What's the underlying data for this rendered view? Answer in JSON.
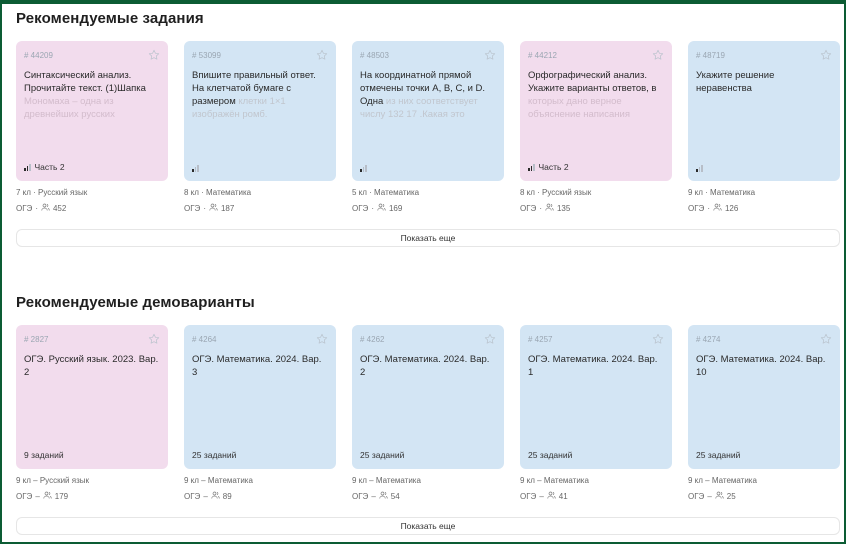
{
  "tasks": {
    "title": "Рекомендуемые задания",
    "show_more": "Показать еще",
    "cards": [
      {
        "color": "pink",
        "num": "# 44209",
        "text": "Синтаксический анализ. Прочитайте текст. (1)Шапка",
        "faded": "Мономаха – одна из древнейших русских",
        "level": 2,
        "part": "Часть 2",
        "grade": "7 кл",
        "subject": "Русский язык",
        "exam": "ОГЭ",
        "users": "452"
      },
      {
        "color": "blue",
        "num": "# 53099",
        "text": "Впишите правильный ответ. На клетчатой бумаге с размером",
        "faded": "клетки 1×1 изображён ромб.",
        "level": 1,
        "part": "",
        "grade": "8 кл",
        "subject": "Математика",
        "exam": "ОГЭ",
        "users": "187"
      },
      {
        "color": "blue",
        "num": "# 48503",
        "text": "На координатной прямой отмечены точки A, B, C, и D. Одна",
        "faded": "из них соответствует числу 132 17 .Какая это",
        "level": 1,
        "part": "",
        "grade": "5 кл",
        "subject": "Математика",
        "exam": "ОГЭ",
        "users": "169"
      },
      {
        "color": "pink",
        "num": "# 44212",
        "text": "Орфографический анализ. Укажите варианты ответов, в",
        "faded": "которых дано верное объяснение написания",
        "level": 2,
        "part": "Часть 2",
        "grade": "8 кл",
        "subject": "Русский язык",
        "exam": "ОГЭ",
        "users": "135"
      },
      {
        "color": "blue",
        "num": "# 48719",
        "text": "Укажите решение неравенства",
        "faded": "",
        "level": 1,
        "part": "",
        "grade": "9 кл",
        "subject": "Математика",
        "exam": "ОГЭ",
        "users": "126"
      }
    ]
  },
  "demos": {
    "title": "Рекомендуемые демоварианты",
    "show_more": "Показать еще",
    "cards": [
      {
        "color": "pink",
        "num": "# 2827",
        "text": "ОГЭ. Русский язык. 2023. Вар. 2",
        "count": "9 заданий",
        "grade": "9 кл",
        "subject": "Русский язык",
        "exam": "ОГЭ",
        "users": "179"
      },
      {
        "color": "blue",
        "num": "# 4264",
        "text": "ОГЭ. Математика. 2024. Вар. 3",
        "count": "25 заданий",
        "grade": "9 кл",
        "subject": "Математика",
        "exam": "ОГЭ",
        "users": "89"
      },
      {
        "color": "blue",
        "num": "# 4262",
        "text": "ОГЭ. Математика. 2024. Вар. 2",
        "count": "25 заданий",
        "grade": "9 кл",
        "subject": "Математика",
        "exam": "ОГЭ",
        "users": "54"
      },
      {
        "color": "blue",
        "num": "# 4257",
        "text": "ОГЭ. Математика. 2024. Вар. 1",
        "count": "25 заданий",
        "grade": "9 кл",
        "subject": "Математика",
        "exam": "ОГЭ",
        "users": "41"
      },
      {
        "color": "blue",
        "num": "# 4274",
        "text": "ОГЭ. Математика. 2024. Вар. 10",
        "count": "25 заданий",
        "grade": "9 кл",
        "subject": "Математика",
        "exam": "ОГЭ",
        "users": "25"
      }
    ]
  },
  "icons": {
    "star": "star-outline-icon",
    "users": "users-icon",
    "difficulty": "difficulty-bars-icon"
  },
  "colors": {
    "pink_card": "#f2dced",
    "blue_card": "#d3e5f4",
    "frame": "#0c5c34"
  }
}
